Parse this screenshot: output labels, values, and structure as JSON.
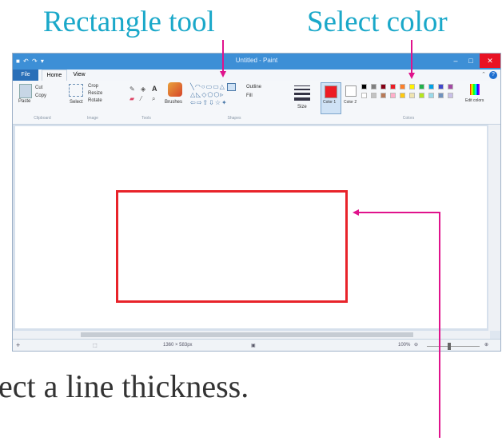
{
  "callouts": {
    "rectangle_tool": "Rectangle tool",
    "select_color": "Select color"
  },
  "caption": "ect a line thickness.",
  "window": {
    "title": "Untitled - Paint",
    "tabs": [
      "File",
      "Home",
      "View"
    ],
    "clipboard": {
      "paste": "Paste",
      "cut": "Cut",
      "copy": "Copy",
      "label": "Clipboard"
    },
    "image": {
      "select": "Select",
      "crop": "Crop",
      "resize": "Resize",
      "rotate": "Rotate",
      "label": "Image"
    },
    "tools": {
      "label": "Tools",
      "text": "A"
    },
    "brushes": "Brushes",
    "shapes": {
      "outline": "Outline",
      "fill": "Fill",
      "label": "Shapes"
    },
    "size": "Size",
    "color1": "Color 1",
    "color2": "Color 2",
    "colors_label": "Colors",
    "edit_colors": "Edit colors",
    "palette_row1": [
      "#000000",
      "#7f7f7f",
      "#880015",
      "#ed1c24",
      "#ff7f27",
      "#fff200",
      "#22b14c",
      "#00a2e8",
      "#3f48cc",
      "#a349a4"
    ],
    "palette_row2": [
      "#ffffff",
      "#c3c3c3",
      "#b97a57",
      "#ffaec9",
      "#ffc90e",
      "#efe4b0",
      "#b5e61d",
      "#99d9ea",
      "#7092be",
      "#c8bfe7"
    ],
    "status": {
      "dimensions": "1360 × 583px",
      "zoom": "100%"
    }
  },
  "colors": {
    "callout": "#1aa8c9",
    "arrow": "#e0138c",
    "rect_stroke": "#e8232a",
    "titlebar": "#3d8fd6",
    "close": "#e81123"
  }
}
